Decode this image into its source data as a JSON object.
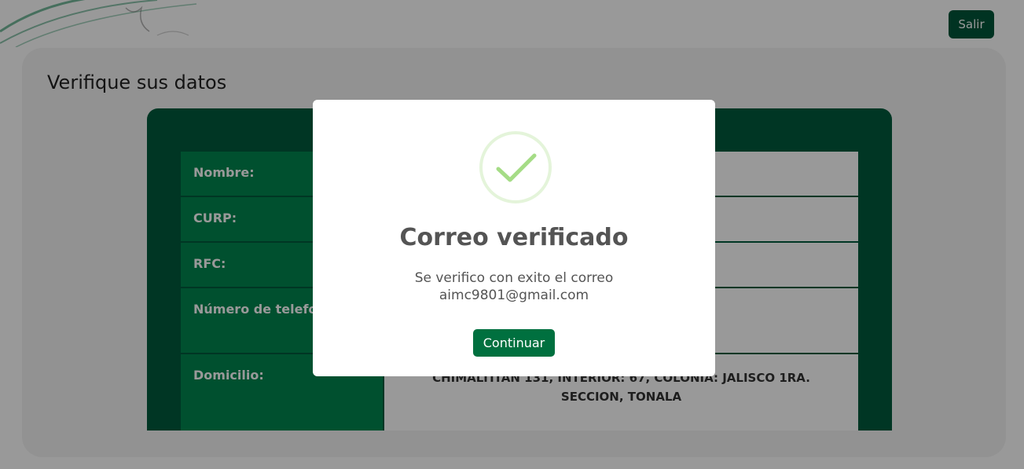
{
  "header": {
    "exit_label": "Salir"
  },
  "card": {
    "title": "Verifique sus datos"
  },
  "data_rows": [
    {
      "label": "Nombre:",
      "value": ""
    },
    {
      "label": "CURP:",
      "value": ""
    },
    {
      "label": "RFC:",
      "value": ""
    },
    {
      "label": "Número de telefono:",
      "value": ""
    },
    {
      "label": "Domicilio:",
      "value": "CHIMALTITAN 131, INTERIOR: 67, COLONIA: JALISCO 1RA. SECCION, TONALA"
    }
  ],
  "modal": {
    "icon": "success-check-icon",
    "title": "Correo verificado",
    "message_line1": "Se verifico con exito el correo",
    "message_line2": "aimc9801@gmail.com",
    "button_label": "Continuar"
  },
  "colors": {
    "primary_dark": "#00563a",
    "primary": "#00864f",
    "check_green": "#a5dc86"
  }
}
